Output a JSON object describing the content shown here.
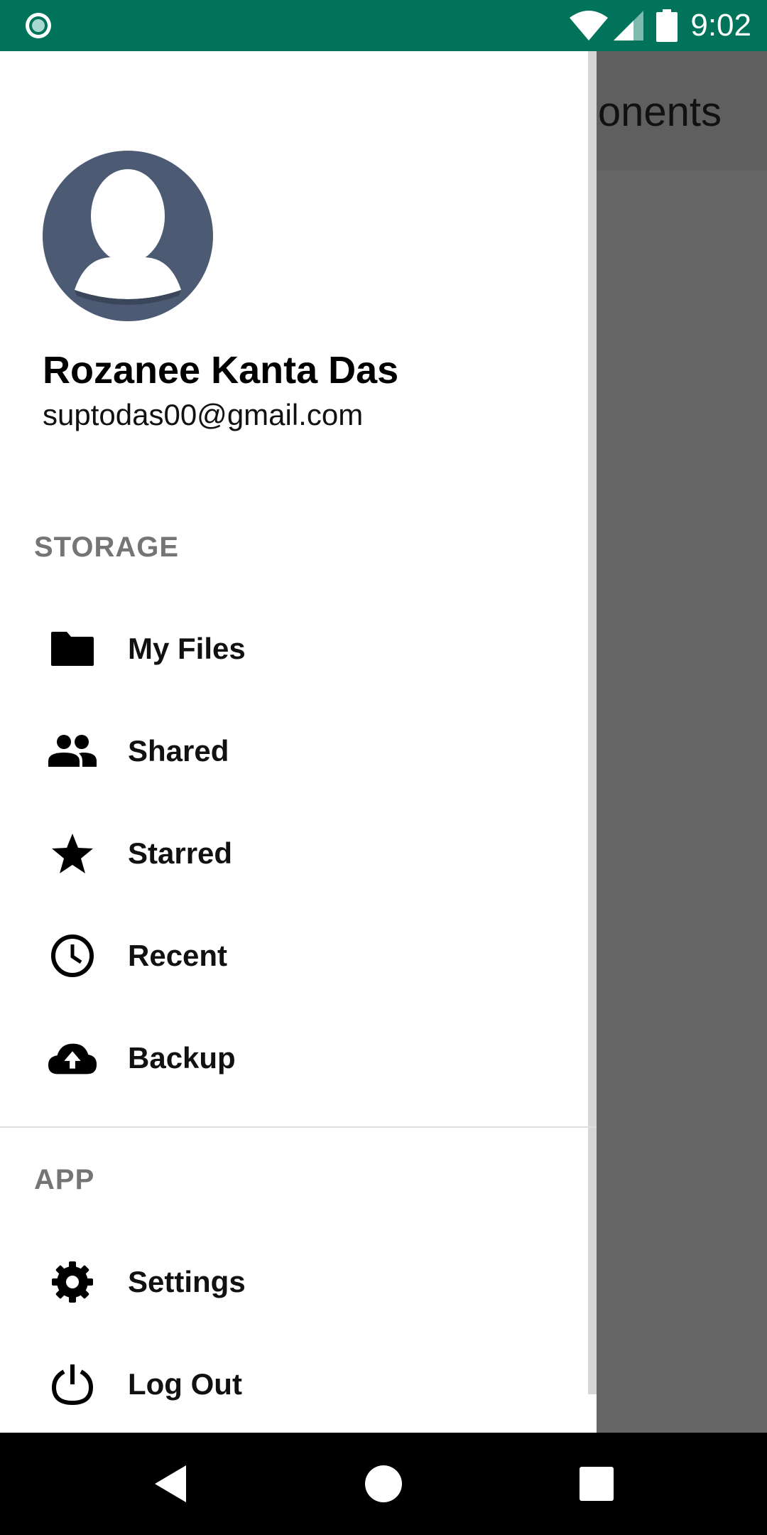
{
  "status_bar": {
    "time": "9:02",
    "icons": [
      "notification-icon",
      "wifi-icon",
      "cell-signal-icon",
      "battery-icon"
    ],
    "background": "#00735a"
  },
  "app_bar": {
    "title_visible": "onents"
  },
  "drawer": {
    "profile": {
      "name": "Rozanee Kanta Das",
      "email": "suptodas00@gmail.com",
      "avatar_color": "#4d5a73"
    },
    "sections": [
      {
        "label": "STORAGE",
        "items": [
          {
            "label": "My Files",
            "icon": "folder-icon"
          },
          {
            "label": "Shared",
            "icon": "people-icon"
          },
          {
            "label": "Starred",
            "icon": "star-icon"
          },
          {
            "label": "Recent",
            "icon": "clock-icon"
          },
          {
            "label": "Backup",
            "icon": "cloud-upload-icon"
          }
        ]
      },
      {
        "label": "APP",
        "items": [
          {
            "label": "Settings",
            "icon": "gear-icon"
          },
          {
            "label": "Log Out",
            "icon": "power-icon"
          }
        ]
      }
    ]
  },
  "nav_bar": {
    "buttons": [
      "back-icon",
      "home-icon",
      "recents-icon"
    ]
  }
}
